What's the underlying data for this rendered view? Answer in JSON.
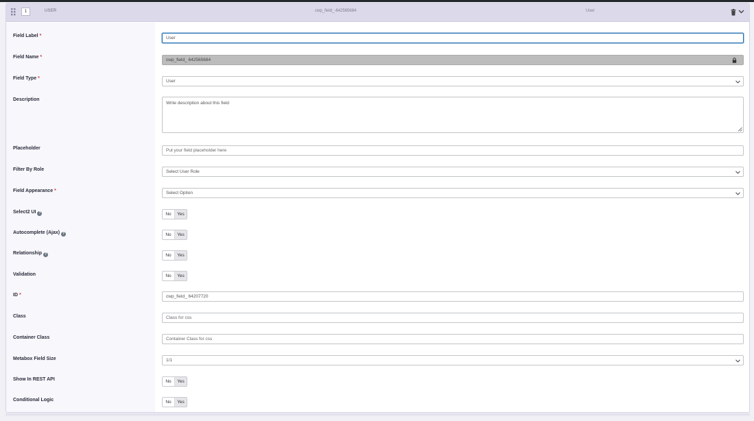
{
  "header": {
    "order": "1",
    "type": "USER",
    "name": "cwp_field_-642565684",
    "label": "User"
  },
  "rows": {
    "field_label": {
      "label": "Field Label",
      "required": "*",
      "value": "User"
    },
    "field_name": {
      "label": "Field Name",
      "required": "*",
      "value": "cwp_field_ 642565684"
    },
    "field_type": {
      "label": "Field Type",
      "required": "*",
      "value": "User"
    },
    "description": {
      "label": "Description",
      "placeholder": "Write description about this field"
    },
    "placeholder": {
      "label": "Placeholder",
      "placeholder": "Put your field placeholder here"
    },
    "filter_by_role": {
      "label": "Filter By Role",
      "value": "Select User Role"
    },
    "field_appearance": {
      "label": "Field Appearance",
      "required": "*",
      "value": "Select Option"
    },
    "select2_ui": {
      "label": "Select2 UI",
      "help": "?",
      "no": "No",
      "yes": "Yes"
    },
    "autocomplete": {
      "label": "Autocomplete (Ajax)",
      "help": "?",
      "no": "No",
      "yes": "Yes"
    },
    "relationship": {
      "label": "Relationship",
      "help": "?",
      "no": "No",
      "yes": "Yes"
    },
    "validation": {
      "label": "Validation",
      "no": "No",
      "yes": "Yes"
    },
    "id": {
      "label": "ID",
      "required": "*",
      "value": "cwp_field_ 64207720"
    },
    "class": {
      "label": "Class",
      "placeholder": "Class for css"
    },
    "container_class": {
      "label": "Container Class",
      "placeholder": "Container Class for css"
    },
    "metabox_field_size": {
      "label": "Metabox Field Size",
      "value": "1/1"
    },
    "show_in_rest": {
      "label": "Show In REST API",
      "no": "No",
      "yes": "Yes"
    },
    "conditional_logic": {
      "label": "Conditional Logic",
      "no": "No",
      "yes": "Yes"
    }
  },
  "colors": {
    "accent": "#2271b1",
    "header_bg": "#dcd9ea",
    "required": "#d63638"
  }
}
